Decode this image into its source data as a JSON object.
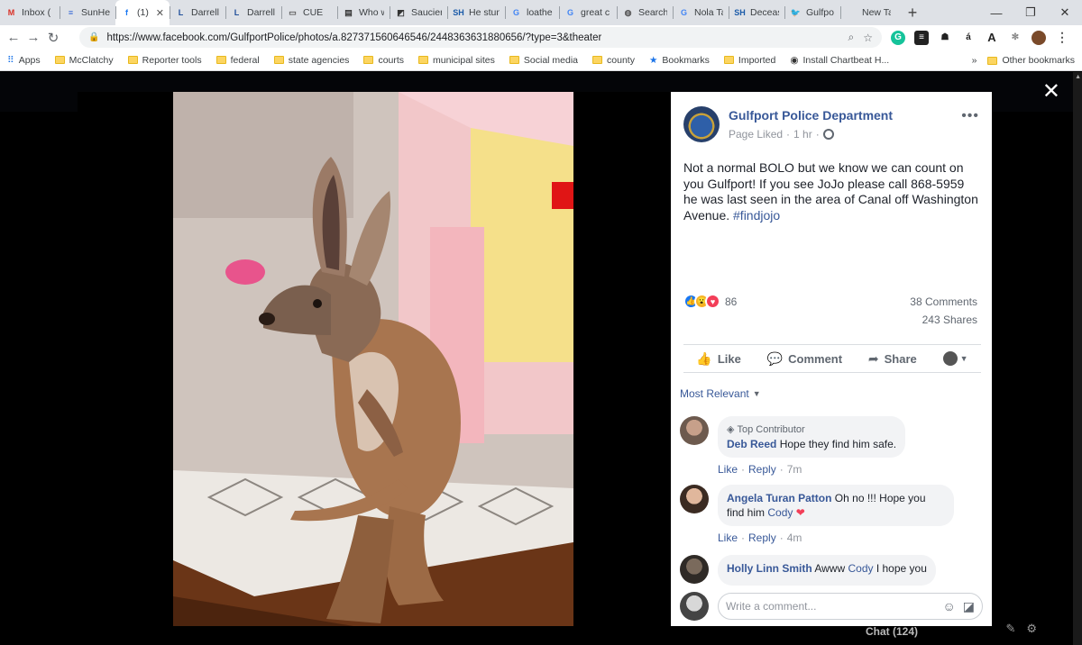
{
  "browser": {
    "tabs": [
      {
        "label": "Inbox (",
        "favicon": "M",
        "favicon_color": "#d93025"
      },
      {
        "label": "SunHer",
        "favicon": "≡",
        "favicon_color": "#3367d6"
      },
      {
        "label": "(1) (",
        "favicon": "f",
        "favicon_color": "#1877f2",
        "active": true
      },
      {
        "label": "Darrell",
        "favicon": "L",
        "favicon_color": "#1f4e9a"
      },
      {
        "label": "Darrell",
        "favicon": "L",
        "favicon_color": "#1f4e9a"
      },
      {
        "label": "CUE",
        "favicon": "▭",
        "favicon_color": "#555555"
      },
      {
        "label": "Who w",
        "favicon": "▤",
        "favicon_color": "#333333"
      },
      {
        "label": "Saucier",
        "favicon": "◩",
        "favicon_color": "#333333"
      },
      {
        "label": "He stun",
        "favicon": "SH",
        "favicon_color": "#1a5aa8"
      },
      {
        "label": "loathe",
        "favicon": "G",
        "favicon_color": "#4285f4"
      },
      {
        "label": "great c",
        "favicon": "G",
        "favicon_color": "#4285f4"
      },
      {
        "label": "Search",
        "favicon": "◍",
        "favicon_color": "#555555"
      },
      {
        "label": "Nola Ta",
        "favicon": "G",
        "favicon_color": "#4285f4"
      },
      {
        "label": "Deceas",
        "favicon": "SH",
        "favicon_color": "#1a5aa8"
      },
      {
        "label": "Gulfpo",
        "favicon": "🐦",
        "favicon_color": "#1da1f2"
      },
      {
        "label": "New Tab",
        "favicon": "",
        "favicon_color": "#ffffff"
      }
    ],
    "new_tab_symbol": "+",
    "window_controls": {
      "minimize": "—",
      "restore": "❐",
      "close": "✕"
    },
    "url": "https://www.facebook.com/GulfportPolice/photos/a.827371560646546/2448363631880656/?type=3&theater",
    "bookmarks": [
      {
        "label": "Apps",
        "kind": "apps"
      },
      {
        "label": "McClatchy",
        "kind": "folder"
      },
      {
        "label": "Reporter tools",
        "kind": "folder"
      },
      {
        "label": "federal",
        "kind": "folder"
      },
      {
        "label": "state agencies",
        "kind": "folder"
      },
      {
        "label": "courts",
        "kind": "folder"
      },
      {
        "label": "municipal sites",
        "kind": "folder"
      },
      {
        "label": "Social media",
        "kind": "folder"
      },
      {
        "label": "county",
        "kind": "folder"
      },
      {
        "label": "Bookmarks",
        "kind": "star"
      },
      {
        "label": "Imported",
        "kind": "folder"
      },
      {
        "label": "Install Chartbeat H...",
        "kind": "link"
      }
    ],
    "bookmarks_overflow": "»",
    "other_bookmarks": "Other bookmarks"
  },
  "post": {
    "page_name": "Gulfport Police Department",
    "liked_status": "Page Liked",
    "time": "1 hr",
    "text": "Not a normal BOLO but we know we can count on you Gulfport! If you see JoJo please call 868-5959 he was last seen in the area of Canal off Washington Avenue.",
    "hashtag": "#findjojo",
    "reaction_count": "86",
    "comments_count": "38 Comments",
    "shares_count": "243 Shares",
    "actions": {
      "like": "Like",
      "comment": "Comment",
      "share": "Share"
    },
    "sort_label": "Most Relevant"
  },
  "comments": [
    {
      "badge": "Top Contributor",
      "author": "Deb Reed",
      "text": "Hope they find him safe.",
      "like": "Like",
      "reply": "Reply",
      "time": "7m"
    },
    {
      "author": "Angela Turan Patton",
      "text": "Oh no !!! Hope you find him",
      "mention": "Cody",
      "like": "Like",
      "reply": "Reply",
      "time": "4m"
    },
    {
      "author": "Holly Linn Smith",
      "text_before": "Awww",
      "mention": "Cody",
      "text_after": "I hope you"
    }
  ],
  "write_comment_placeholder": "Write a comment...",
  "chat_label": "Chat (124)",
  "colors": {
    "fb_blue": "#385898",
    "chrome_tabstrip": "#dee1e6",
    "theater_bg": "#000000"
  }
}
